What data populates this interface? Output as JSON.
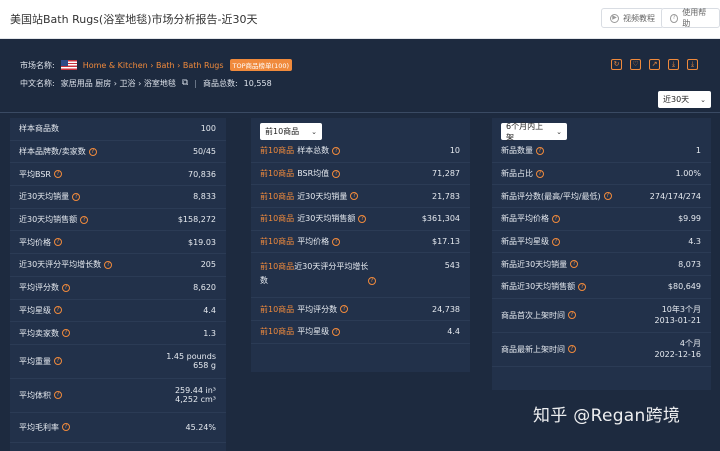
{
  "topbar": {
    "title": "美国站Bath Rugs(浴室地毯)市场分析报告-近30天",
    "video_btn": "视频教程",
    "help_btn": "使用帮助"
  },
  "header": {
    "market_label": "市场名称:",
    "crumbs": "Home & Kitchen › Bath › Bath Rugs",
    "top_badge": "TOP商品榜单(100)",
    "cn_label": "中文名称:",
    "cn_crumbs": "家居用品 厨房 › 卫浴 › 浴室地毯",
    "sep": "|",
    "total_label": "商品总数:",
    "total_value": "10,558"
  },
  "range_select": "近30天",
  "panel1": {
    "rows": [
      {
        "k": "样本商品数",
        "v": "100",
        "q": false
      },
      {
        "k": "样本品牌数/卖家数",
        "v": "50/45",
        "q": true
      },
      {
        "k": "平均BSR",
        "v": "70,836",
        "q": true
      },
      {
        "k": "近30天均销量",
        "v": "8,833",
        "q": true
      },
      {
        "k": "近30天均销售额",
        "v": "$158,272",
        "q": true
      },
      {
        "k": "平均价格",
        "v": "$19.03",
        "q": true
      },
      {
        "k": "近30天评分平均增长数",
        "v": "205",
        "q": true
      },
      {
        "k": "平均评分数",
        "v": "8,620",
        "q": true
      },
      {
        "k": "平均星级",
        "v": "4.4",
        "q": true
      },
      {
        "k": "平均卖家数",
        "v": "1.3",
        "q": true
      }
    ],
    "weight": {
      "k": "平均重量",
      "v1": "1.45 pounds",
      "v2": "658 g"
    },
    "volume": {
      "k": "平均体积",
      "v1": "259.44 in³",
      "v2": "4,252 cm³"
    },
    "margin": {
      "k": "平均毛利率",
      "v": "45.24%"
    }
  },
  "panel2": {
    "select": "前10商品",
    "prefix": "前10商品",
    "rows": [
      {
        "k": "样本总数",
        "v": "10"
      },
      {
        "k": "BSR均值",
        "v": "71,287"
      },
      {
        "k": "近30天均销量",
        "v": "21,783"
      },
      {
        "k": "近30天均销售额",
        "v": "$361,304"
      },
      {
        "k": "平均价格",
        "v": "$17.13"
      }
    ],
    "growth": {
      "k1": "近30天评分平均增长",
      "k2": "数",
      "v": "543"
    },
    "rows2": [
      {
        "k": "平均评分数",
        "v": "24,738"
      },
      {
        "k": "平均星级",
        "v": "4.4"
      }
    ]
  },
  "panel3": {
    "select": "6个月内上架",
    "rows": [
      {
        "k": "新品数量",
        "v": "1"
      },
      {
        "k": "新品占比",
        "v": "1.00%"
      },
      {
        "k": "新品评分数(最高/平均/最低)",
        "v": "274/174/274"
      },
      {
        "k": "新品平均价格",
        "v": "$9.99"
      },
      {
        "k": "新品平均星级",
        "v": "4.3"
      },
      {
        "k": "新品近30天均销量",
        "v": "8,073"
      },
      {
        "k": "新品近30天均销售额",
        "v": "$80,649"
      }
    ],
    "first_listed": {
      "k": "商品首次上架时间",
      "v1": "10年3个月",
      "v2": "2013-01-21"
    },
    "newest_listed": {
      "k": "商品最新上架时间",
      "v1": "4个月",
      "v2": "2022-12-16"
    }
  },
  "watermark": "知乎 @Regan跨境",
  "icons": {
    "help": "question-circle-icon",
    "flag": "us-flag-icon"
  },
  "colors": {
    "accent": "#f08a3c",
    "bg": "#1d2a3f",
    "panel": "#22314a"
  }
}
